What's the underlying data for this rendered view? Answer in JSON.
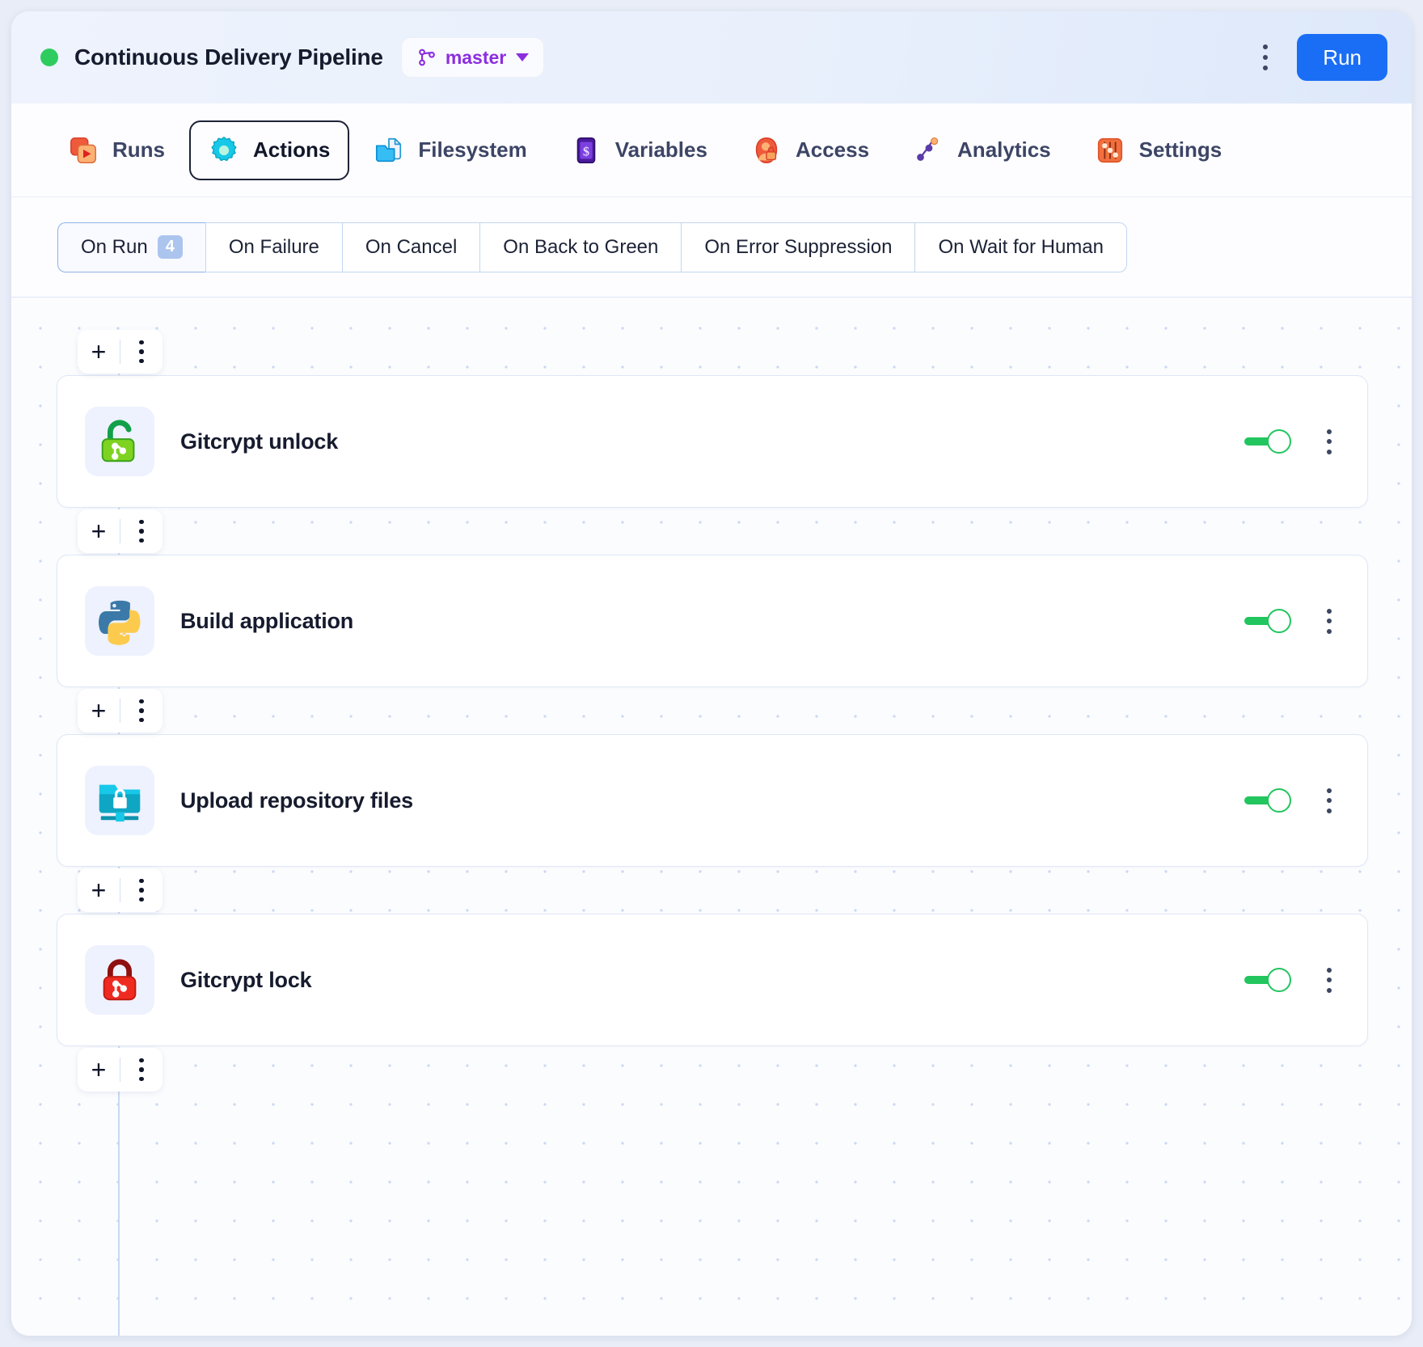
{
  "header": {
    "status": "running-dot",
    "title": "Continuous Delivery Pipeline",
    "branch": "master",
    "menu_icon": "kebab-menu-icon",
    "run_label": "Run",
    "accent_blue": "#1a6ef5",
    "branch_purple": "#8b2ee0",
    "status_green": "#2ecc5f"
  },
  "nav": {
    "tabs": [
      {
        "label": "Runs",
        "icon": "runs-icon",
        "active": false
      },
      {
        "label": "Actions",
        "icon": "actions-gear-icon",
        "active": true
      },
      {
        "label": "Filesystem",
        "icon": "filesystem-folder-icon",
        "active": false
      },
      {
        "label": "Variables",
        "icon": "variables-dollar-icon",
        "active": false
      },
      {
        "label": "Access",
        "icon": "access-user-lock-icon",
        "active": false
      },
      {
        "label": "Analytics",
        "icon": "analytics-graph-icon",
        "active": false
      },
      {
        "label": "Settings",
        "icon": "settings-sliders-icon",
        "active": false
      }
    ]
  },
  "triggers": {
    "tabs": [
      {
        "label": "On Run",
        "badge": "4",
        "active": true
      },
      {
        "label": "On Failure",
        "badge": "",
        "active": false
      },
      {
        "label": "On Cancel",
        "badge": "",
        "active": false
      },
      {
        "label": "On Back to Green",
        "badge": "",
        "active": false
      },
      {
        "label": "On Error Suppression",
        "badge": "",
        "active": false
      },
      {
        "label": "On Wait for Human",
        "badge": "",
        "active": false
      }
    ]
  },
  "connector": {
    "add_label": "+",
    "menu_icon": "kebab-menu-icon"
  },
  "actions": [
    {
      "title": "Gitcrypt unlock",
      "icon": "gitcrypt-unlock-icon",
      "enabled": true
    },
    {
      "title": "Build application",
      "icon": "python-icon",
      "enabled": true
    },
    {
      "title": "Upload repository files",
      "icon": "upload-folder-lock-icon",
      "enabled": true
    },
    {
      "title": "Gitcrypt lock",
      "icon": "gitcrypt-lock-icon",
      "enabled": true
    }
  ]
}
